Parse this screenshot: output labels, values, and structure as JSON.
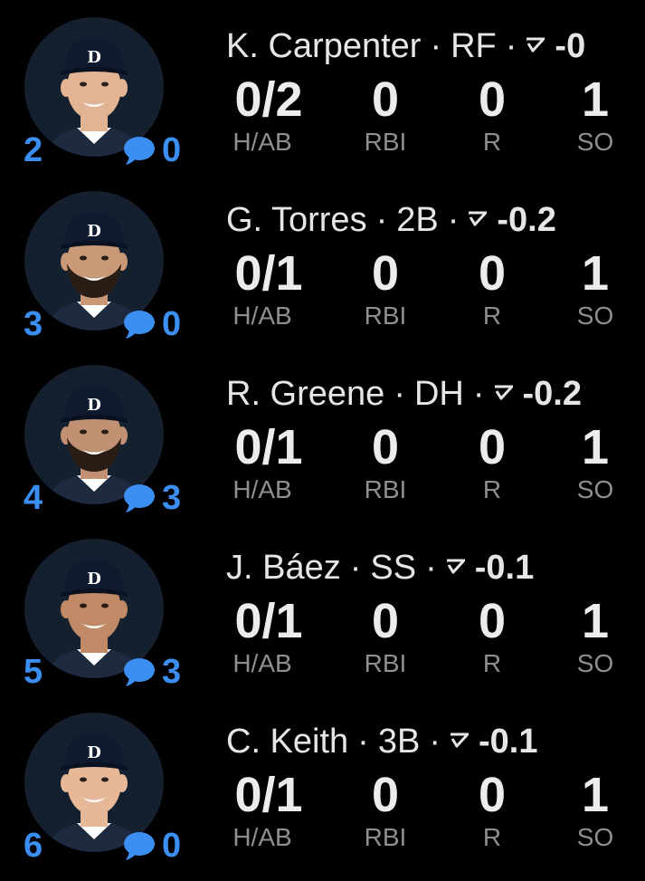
{
  "colors": {
    "background": "#000000",
    "accent": "#3b8ff2",
    "text": "#e6e6e6",
    "muted": "#8e8e93"
  },
  "stat_labels": [
    "H/AB",
    "RBI",
    "R",
    "SO"
  ],
  "players": [
    {
      "order": "2",
      "comments": "0",
      "name": "K. Carpenter",
      "position": "RF",
      "delta_icon": "trend-down-icon",
      "delta": "-0",
      "stats": [
        "0/2",
        "0",
        "0",
        "1"
      ],
      "beard": false,
      "skin": "#e3b493"
    },
    {
      "order": "3",
      "comments": "0",
      "name": "G. Torres",
      "position": "2B",
      "delta_icon": "trend-down-icon",
      "delta": "-0.2",
      "stats": [
        "0/1",
        "0",
        "0",
        "1"
      ],
      "beard": true,
      "skin": "#c99876"
    },
    {
      "order": "4",
      "comments": "3",
      "name": "R. Greene",
      "position": "DH",
      "delta_icon": "trend-down-icon",
      "delta": "-0.2",
      "stats": [
        "0/1",
        "0",
        "0",
        "1"
      ],
      "beard": true,
      "skin": "#c29072"
    },
    {
      "order": "5",
      "comments": "3",
      "name": "J. Báez",
      "position": "SS",
      "delta_icon": "trend-down-icon",
      "delta": "-0.1",
      "stats": [
        "0/1",
        "0",
        "0",
        "1"
      ],
      "beard": false,
      "skin": "#c08a66"
    },
    {
      "order": "6",
      "comments": "0",
      "name": "C. Keith",
      "position": "3B",
      "delta_icon": "trend-down-icon",
      "delta": "-0.1",
      "stats": [
        "0/1",
        "0",
        "0",
        "1"
      ],
      "beard": false,
      "skin": "#e6b898"
    }
  ]
}
